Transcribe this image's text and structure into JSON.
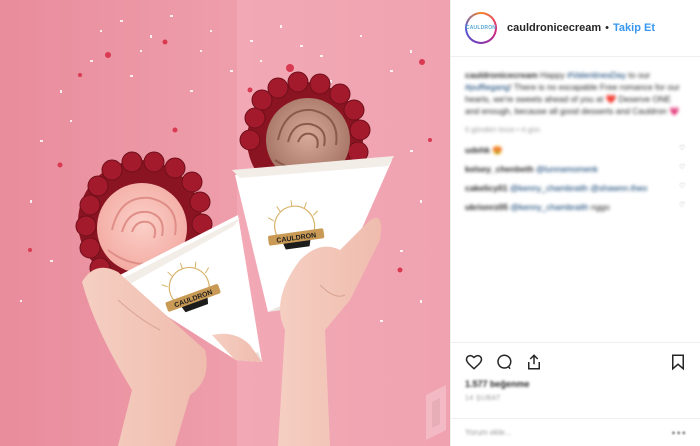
{
  "header": {
    "username": "cauldronicecream",
    "separator": "•",
    "follow_label": "Takip Et",
    "avatar_text": "CAULDRON"
  },
  "post": {
    "cone_brand": "CAULDRON",
    "caption": {
      "user": "cauldronicecream",
      "text": "Happy",
      "hashtag1": "#ValentinesDay",
      "text2": "to our",
      "hashtag2": "#puffiegang",
      "text3": "! There is no escapable Free romance for our hearts, we're sweets ahead of you at ❤️ Deserve ONE and enough, because all good desserts and Cauldron 💗"
    },
    "caption_time": "5 gönderi önce • 4 gün",
    "comments": [
      {
        "user": "udehk",
        "text": "😍",
        "tag": ""
      },
      {
        "user": "kelsey_chenbeth",
        "text": "",
        "tag": "@lunnamomenk"
      },
      {
        "user": "cakelicy01",
        "text": "",
        "tag": "@kenny_chambraith @shawnn.theo"
      },
      {
        "user": "ukrionrz05",
        "text": "",
        "tag": "@kenny_chambraith",
        "extra": "nggo"
      }
    ]
  },
  "actions": {
    "likes": "1.577 beğenme",
    "date": "14 ŞUBAT",
    "add_comment": "Yorum ekle...",
    "more": "•••"
  },
  "colors": {
    "photo_bg": "#ec9aa8",
    "link": "#3897f0",
    "text": "#262626"
  }
}
